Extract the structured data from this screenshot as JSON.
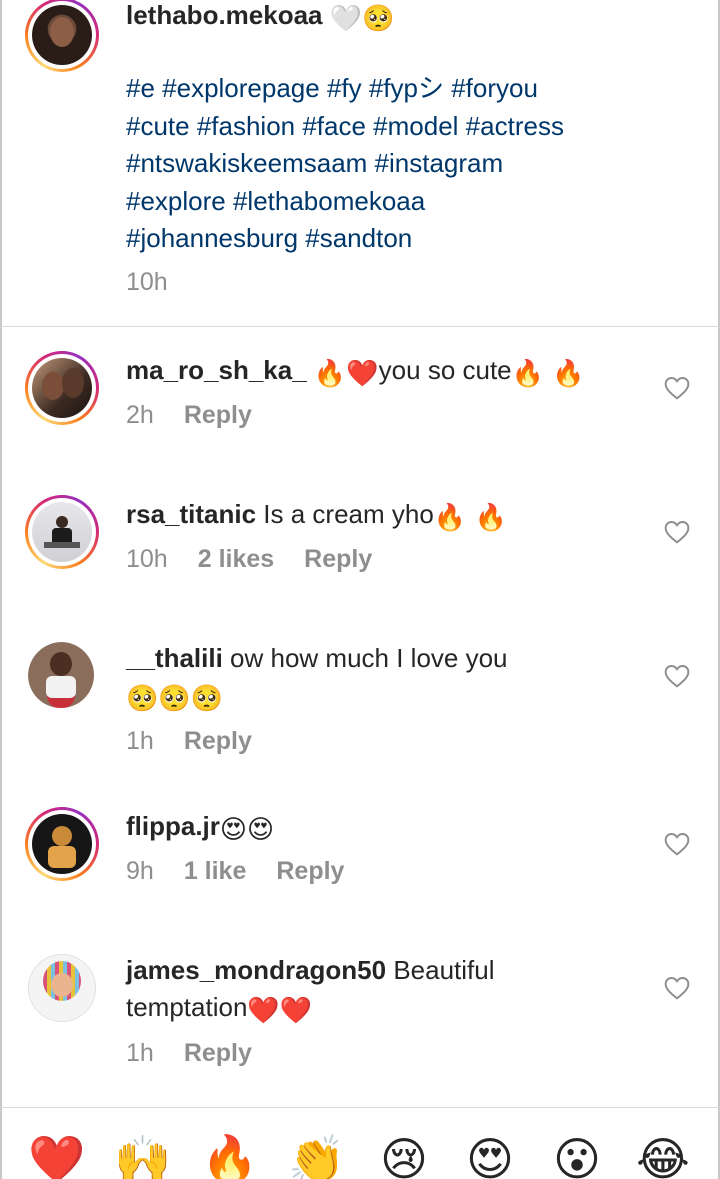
{
  "post": {
    "username": "lethabo.mekoaa",
    "title_emojis": [
      "🤍",
      "🥺"
    ],
    "hashtag_lines": [
      "#e #explorepage #fy #fypシ #foryou",
      "#cute #fashion #face #model #actress",
      "#ntswakiskeemsaam #instagram",
      "#explore #lethabomekoaa",
      "#johannesburg #sandton"
    ],
    "time": "10h"
  },
  "comments": [
    {
      "username": "ma_ro_sh_ka_",
      "text_before": " ",
      "emojis_a": "🔥❤️",
      "text": "you so cute",
      "emojis_b": "🔥 🔥",
      "time": "2h",
      "likes": "",
      "reply": "Reply"
    },
    {
      "username": "rsa_titanic",
      "text": " Is a cream yho",
      "emojis": "🔥 🔥",
      "time": "10h",
      "likes": "2 likes",
      "reply": "Reply"
    },
    {
      "username": "__thalili",
      "text": " ow how much I love you",
      "emojis_line2": "🥺🥺🥺",
      "time": "1h",
      "likes": "",
      "reply": "Reply"
    },
    {
      "username": "flippa.jr",
      "emojis": " 😍😍",
      "time": "9h",
      "likes": "1 like",
      "reply": "Reply"
    },
    {
      "username": "james_mondragon50",
      "text": " Beautiful",
      "text_line2": "temptation",
      "emojis_line2": "❤️❤️",
      "time": "1h",
      "likes": "",
      "reply": "Reply"
    }
  ],
  "quick_reactions": [
    "❤️",
    "🙌",
    "🔥",
    "👏",
    "😢",
    "😍",
    "😮",
    "😂"
  ],
  "colors": {
    "hashtag": "#00376b",
    "meta": "#8e8e8e",
    "text": "#262626",
    "divider": "#dbdbdb"
  }
}
